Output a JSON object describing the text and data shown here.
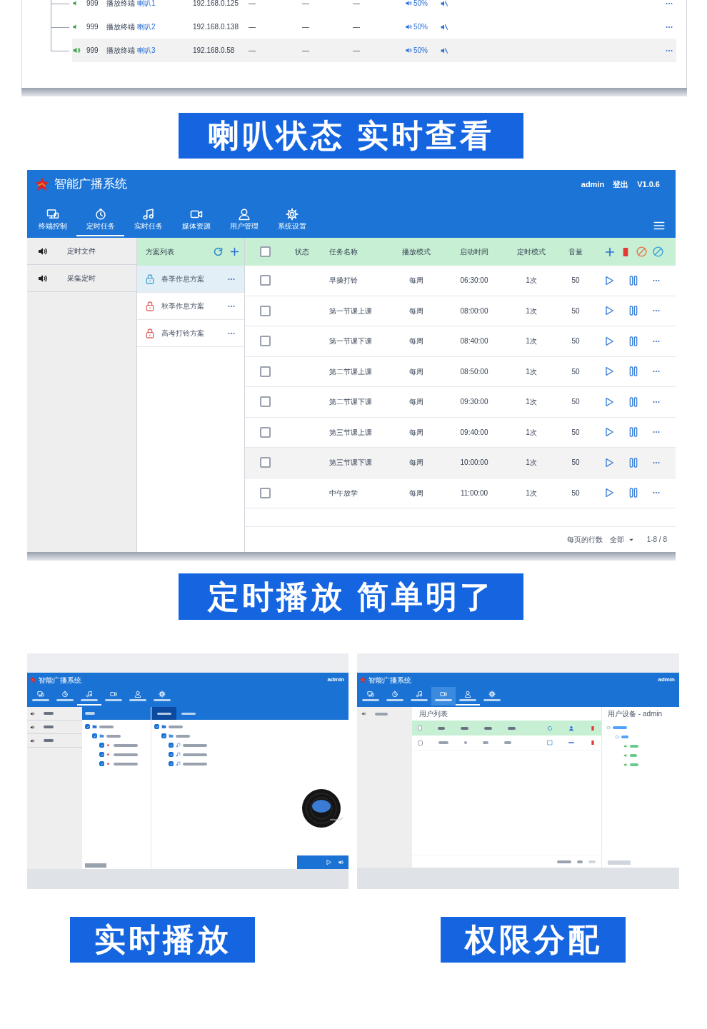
{
  "speaker_list": {
    "rows": [
      {
        "number": "999",
        "type": "播放终端",
        "name": "喇叭1",
        "ip": "192.168.0.125",
        "column_5": "—",
        "column_6": "—",
        "column_7": "—",
        "volume": "50%",
        "kind": "idle",
        "selected": false
      },
      {
        "number": "999",
        "type": "播放终端",
        "name": "喇叭2",
        "ip": "192.168.0.138",
        "column_5": "—",
        "column_6": "—",
        "column_7": "—",
        "volume": "50%",
        "kind": "idle",
        "selected": false
      },
      {
        "number": "999",
        "type": "播放终端",
        "name": "喇叭3",
        "ip": "192.168.0.58",
        "column_5": "—",
        "column_6": "—",
        "column_7": "—",
        "volume": "50%",
        "kind": "playing",
        "selected": true
      }
    ]
  },
  "caption_1": "喇叭状态 实时查看",
  "scheduler_window": {
    "title": "智能广播系统",
    "user": "admin",
    "logout": "登出",
    "version": "V1.0.6",
    "nav": [
      {
        "label": "终端控制",
        "selected": false
      },
      {
        "label": "定时任务",
        "selected": true
      },
      {
        "label": "实时任务",
        "selected": false
      },
      {
        "label": "媒体资源",
        "selected": false
      },
      {
        "label": "用户管理",
        "selected": false
      },
      {
        "label": "系统设置",
        "selected": false
      }
    ],
    "sidebar": [
      {
        "label": "定时文件"
      },
      {
        "label": "采集定时"
      }
    ],
    "plan_list": {
      "title": "方案列表",
      "items": [
        {
          "label": "春季作息方案",
          "selected": true
        },
        {
          "label": "秋季作息方案",
          "selected": false
        },
        {
          "label": "高考打铃方案",
          "selected": false
        }
      ]
    },
    "table": {
      "all_checked": false,
      "columns": [
        "状态",
        "任务名称",
        "播放模式",
        "启动时间",
        "定时模式",
        "音量"
      ],
      "rows": [
        {
          "name": "早操打铃",
          "mode": "每周",
          "time": "06:30:00",
          "schedule": "1次",
          "volume": "50",
          "checked": false,
          "selected": false
        },
        {
          "name": "第一节课上课",
          "mode": "每周",
          "time": "08:00:00",
          "schedule": "1次",
          "volume": "50",
          "checked": false,
          "selected": false
        },
        {
          "name": "第一节课下课",
          "mode": "每周",
          "time": "08:40:00",
          "schedule": "1次",
          "volume": "50",
          "checked": false,
          "selected": false
        },
        {
          "name": "第二节课上课",
          "mode": "每周",
          "time": "08:50:00",
          "schedule": "1次",
          "volume": "50",
          "checked": false,
          "selected": false
        },
        {
          "name": "第二节课下课",
          "mode": "每周",
          "time": "09:30:00",
          "schedule": "1次",
          "volume": "50",
          "checked": false,
          "selected": false
        },
        {
          "name": "第三节课上课",
          "mode": "每周",
          "time": "09:40:00",
          "schedule": "1次",
          "volume": "50",
          "checked": false,
          "selected": false
        },
        {
          "name": "第三节课下课",
          "mode": "每周",
          "time": "10:00:00",
          "schedule": "1次",
          "volume": "50",
          "checked": false,
          "selected": true
        },
        {
          "name": "中午放学",
          "mode": "每周",
          "time": "11:00:00",
          "schedule": "1次",
          "volume": "50",
          "checked": false,
          "selected": false
        }
      ]
    },
    "footer": {
      "rows_per_page_label": "每页的行数",
      "rows_per_page": "全部",
      "range": "1-8 / 8"
    }
  },
  "caption_2": "定时播放 简单明了",
  "live_play_window": {
    "title": "智能广播系统",
    "user": "admin",
    "nav": [
      {
        "selected": false
      },
      {
        "selected": false
      },
      {
        "selected": true
      },
      {
        "selected": false
      },
      {
        "selected": false
      },
      {
        "selected": false
      }
    ],
    "device_tree": [
      {
        "checked": true,
        "children": [
          {
            "checked": true,
            "children": [
              {
                "checked": true
              },
              {
                "checked": true
              },
              {
                "checked": true
              }
            ]
          }
        ]
      }
    ],
    "media_tabs": [
      {
        "selected": true
      },
      {
        "selected": false
      }
    ],
    "media_tree": [
      {
        "checked": true,
        "children": [
          {
            "checked": true,
            "children": [
              {
                "checked": true
              },
              {
                "checked": true
              },
              {
                "checked": true
              }
            ]
          }
        ]
      }
    ]
  },
  "permissions_window": {
    "title": "智能广播系统",
    "user": "admin",
    "nav": [
      {
        "selected": false,
        "hovered": false
      },
      {
        "selected": false,
        "hovered": false
      },
      {
        "selected": false,
        "hovered": false
      },
      {
        "selected": false,
        "hovered": true
      },
      {
        "selected": true,
        "hovered": false
      },
      {
        "selected": false,
        "hovered": false
      }
    ],
    "user_list_title": "用户列表",
    "all_checked": false,
    "user_rows": [
      {
        "checked": false
      }
    ],
    "device_panel_title": "用户设备 - admin"
  },
  "captions_bottom": [
    "实时播放",
    "权限分配"
  ]
}
